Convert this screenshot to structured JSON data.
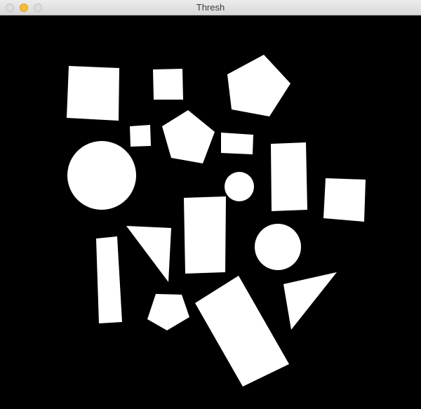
{
  "window": {
    "title": "Thresh",
    "buttons": {
      "close": "close-button",
      "minimize": "minimize-button",
      "zoom": "zoom-button"
    }
  },
  "colors": {
    "background": "#000000",
    "shape_fill": "#ffffff",
    "titlebar": "#e6e6e6",
    "minimize": "#f5bd33"
  },
  "image": {
    "kind": "binary threshold image",
    "shapes": [
      {
        "type": "square"
      },
      {
        "type": "square"
      },
      {
        "type": "pentagon"
      },
      {
        "type": "square"
      },
      {
        "type": "pentagon"
      },
      {
        "type": "rectangle"
      },
      {
        "type": "circle"
      },
      {
        "type": "rectangle"
      },
      {
        "type": "circle"
      },
      {
        "type": "square"
      },
      {
        "type": "rectangle"
      },
      {
        "type": "triangle"
      },
      {
        "type": "circle"
      },
      {
        "type": "rectangle"
      },
      {
        "type": "pentagon"
      },
      {
        "type": "rectangle"
      },
      {
        "type": "triangle"
      }
    ]
  }
}
